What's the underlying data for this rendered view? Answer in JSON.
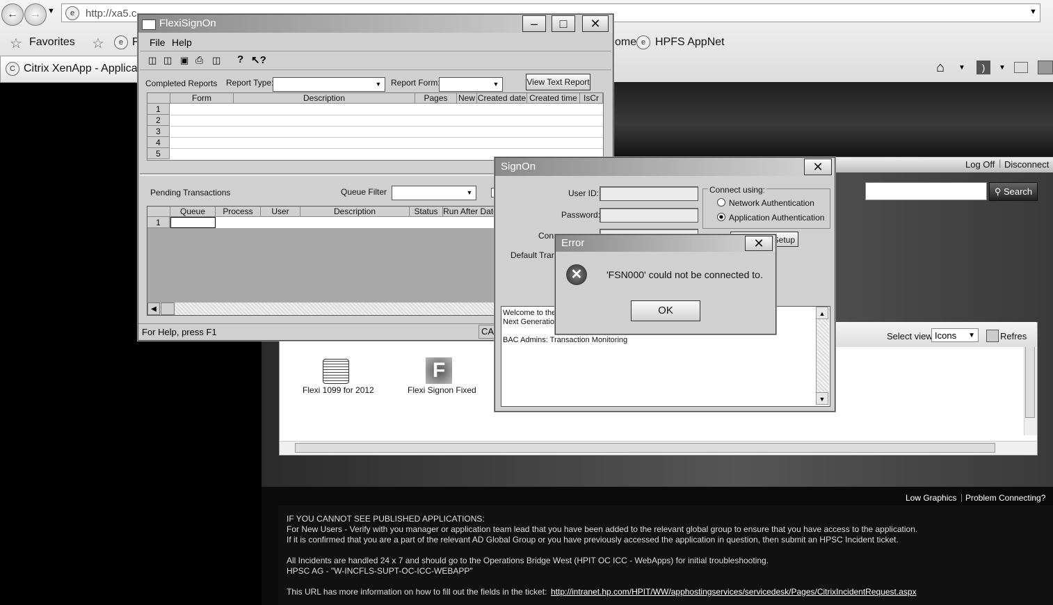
{
  "browser": {
    "address": "http://xa5.c...",
    "favorites_label": "Favorites",
    "fav_bar_item_partial": "F",
    "fav_bar_item_home_partial": "ome",
    "fav_bar_item_appnet": "HPFS AppNet",
    "tab_label": "Citrix XenApp - Applicat"
  },
  "citrix": {
    "log_off": "Log Off",
    "disconnect": "Disconnect",
    "search_label": "Search",
    "select_view_label": "Select view:",
    "select_view_value": "Icons",
    "refresh_label": "Refres",
    "apps": [
      {
        "label": "Flexi 1099 for 2012"
      },
      {
        "label": "Flexi Signon Fixed"
      }
    ],
    "low_graphics": "Low Graphics",
    "problem_connecting": "Problem Connecting?",
    "footer_lines": [
      "IF YOU CANNOT SEE PUBLISHED APPLICATIONS:",
      "For New Users - Verify with you manager or application team lead that you have been added to the relevant global group to ensure that you have access to the application.",
      "If it is confirmed that you are a part of the relevant AD Global Group or you have previously accessed the application in question, then submit an HPSC Incident ticket.",
      "All Incidents are handled 24 x 7 and should go to the Operations Bridge West (HPIT OC ICC - WebApps) for initial troubleshooting.",
      "HPSC AG - \"W-INCFLS-SUPT-OC-ICC-WEBAPP\""
    ],
    "footer_url_prefix": "This URL has more information on how to fill out the fields in the ticket:",
    "footer_url": "http://intranet.hp.com/HPIT/WW/apphostingservices/servicedesk/Pages/CitrixIncidentRequest.aspx"
  },
  "flexi": {
    "title": "FlexiSignOn",
    "menu": [
      "File",
      "Help"
    ],
    "completed_reports": "Completed Reports",
    "report_type_label": "Report Type:",
    "report_form_label": "Report Form:",
    "view_text_report": "View Text Report",
    "columns": [
      "Form",
      "Description",
      "Pages",
      "New",
      "Created date",
      "Created time",
      "IsCr"
    ],
    "rows": [
      "1",
      "2",
      "3",
      "4",
      "5"
    ],
    "pending_transactions": "Pending Transactions",
    "queue_filter_label": "Queue Filter",
    "pending_columns": [
      "Queue",
      "Process",
      "User",
      "Description",
      "Status",
      "Run After Date"
    ],
    "pending_rows": [
      "1"
    ],
    "status_bar": "For Help, press F1",
    "status_cap": "CA"
  },
  "signon": {
    "title": "SignOn",
    "user_id_label": "User ID:",
    "password_label": "Password:",
    "connection_alias_label_partial": "Conn",
    "default_trans_label_partial": "Default Trans",
    "connect_using": "Connect using:",
    "network_auth": "Network Authentication",
    "app_auth": "Application Authentication",
    "setup_label_partial": "Setup",
    "welcome_line1_partial": "Welcome to the",
    "welcome_line2_partial": "Next Generation",
    "bac_admins": "BAC Admins:  Transaction Monitoring"
  },
  "error": {
    "title": "Error",
    "message": "'FSN000' could not be connected to.",
    "ok": "OK"
  }
}
